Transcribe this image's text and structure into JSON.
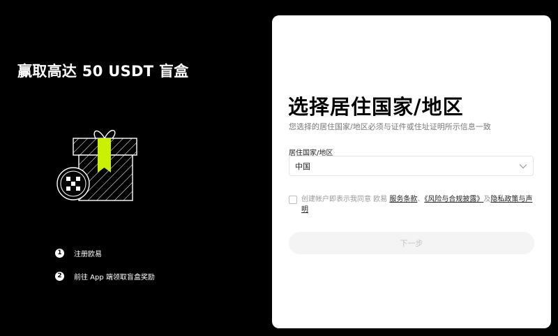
{
  "promo": {
    "title": "赢取高达 50 USDT 盲盒",
    "steps": [
      {
        "num": "1",
        "text": "注册欧易"
      },
      {
        "num": "2",
        "text": "前往 App 端领取盲盒奖励"
      }
    ]
  },
  "form": {
    "title": "选择居住国家/地区",
    "subtitle": "您选择的居住国家/地区必须与证件或住址证明所示信息一致",
    "country_label": "居住国家/地区",
    "country_value": "中国",
    "consent": {
      "prefix": "创建帐户即表示我同意 欧易 ",
      "terms_link": "服务条款",
      "sep1": "、",
      "risk_link": "《风险与合规披露》",
      "sep2": "及",
      "privacy_link": "隐私政策与声明"
    },
    "next_label": "下一步"
  },
  "colors": {
    "accent": "#c8f000",
    "background": "#000000",
    "card": "#ffffff"
  }
}
